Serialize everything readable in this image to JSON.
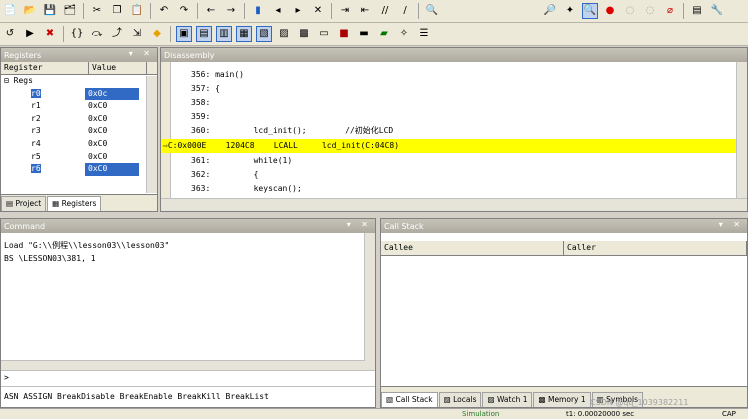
{
  "toolbar1": {
    "icons": [
      "new-file-icon",
      "open-icon",
      "save-icon",
      "save-all-icon",
      "cut-icon",
      "copy-icon",
      "paste-icon",
      "undo-icon",
      "redo-icon",
      "nav-back-icon",
      "nav-forward-icon",
      "bookmark-icon",
      "bookmark-prev-icon",
      "bookmark-next-icon",
      "bookmark-clear-icon",
      "indent-icon",
      "unindent-icon",
      "comment-icon",
      "uncomment-icon",
      "find-in-files-icon",
      "search-icon",
      "debug-icon",
      "breakpoint-icon",
      "breakpoint-disable-icon",
      "breakpoint-kill-icon",
      "window-icon",
      "wrench-icon"
    ]
  },
  "toolbar2": {
    "icons": [
      "reset-icon",
      "run-icon",
      "stop-icon",
      "step-into-icon",
      "step-over-icon",
      "step-out-icon",
      "run-to-cursor-icon",
      "show-next-icon",
      "command-window-icon",
      "disassembly-window-icon",
      "symbols-window-icon",
      "registers-window-icon",
      "call-stack-icon",
      "watch-window-icon",
      "memory-window-icon",
      "serial-window-icon",
      "logic-analyzer-icon",
      "performance-icon",
      "trace-icon",
      "toolbox-icon",
      "system-viewer-icon"
    ]
  },
  "registers": {
    "title": "Registers",
    "col_register": "Register",
    "col_value": "Value",
    "group": "Regs",
    "rows": [
      {
        "name": "r0",
        "value": "0x0c"
      },
      {
        "name": "r1",
        "value": "0xC0"
      },
      {
        "name": "r2",
        "value": "0xC0"
      },
      {
        "name": "r3",
        "value": "0xC0"
      },
      {
        "name": "r4",
        "value": "0xC0"
      },
      {
        "name": "r5",
        "value": "0xC0"
      },
      {
        "name": "r6",
        "value": "0xC0"
      }
    ],
    "tabs": [
      "Project",
      "Registers"
    ]
  },
  "disassembly": {
    "title": "Disassembly",
    "lines": [
      "356: main()",
      "357: {",
      "358:",
      "359:",
      "360:         lcd_init();        //初始化LCD",
      "C:0x000E    1204C8    LCALL     lcd_init(C:04C8)",
      "361:         while(1)",
      "362:         {",
      "363:         keyscan();"
    ],
    "current_line_index": 5
  },
  "command": {
    "title": "Command",
    "lines": [
      "Load \"G:\\\\例程\\\\lesson03\\\\lesson03\"",
      "BS \\LESSON03\\381, 1"
    ],
    "prompt": ">",
    "hint": "ASN ASSIGN BreakDisable BreakEnable BreakKill BreakList"
  },
  "callstack": {
    "title": "Call Stack",
    "col_callee": "Callee",
    "col_caller": "Caller",
    "tabs": [
      "Call Stack",
      "Locals",
      "Watch 1",
      "Memory 1",
      "Symbols"
    ]
  },
  "status": {
    "mode": "Simulation",
    "time": "t1: 0.00020000 sec",
    "watermark": "CSDN @qq_1039382211",
    "caps": "CAP"
  },
  "colors": {
    "highlight": "#ffff00",
    "selection": "#316ac5"
  }
}
